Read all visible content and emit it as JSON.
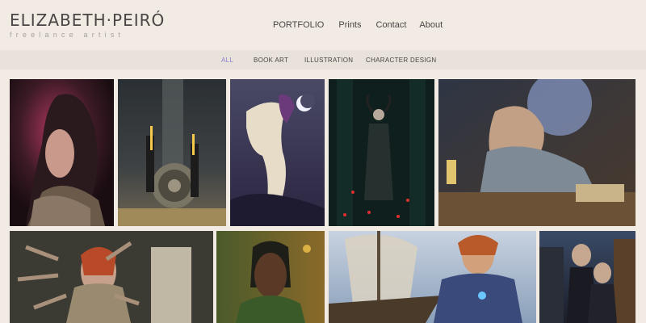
{
  "site": {
    "name": "ELIZABETH·PEIRÓ",
    "tagline": "freelance artist"
  },
  "nav": {
    "items": [
      "PORTFOLIO",
      "Prints",
      "Contact",
      "About"
    ]
  },
  "filters": {
    "items": [
      "ALL",
      "BOOK ART",
      "ILLUSTRATION",
      "CHARACTER DESIGN"
    ],
    "active": "ALL",
    "active_color": "#8d7fd0"
  },
  "gallery": {
    "items": [
      {
        "subject": "hooded warrior portrait in pink light"
      },
      {
        "subject": "two figures with glowing swords beside an ornate round shield"
      },
      {
        "subject": "rider on a rearing white horse under a crescent moon"
      },
      {
        "subject": "horned woman in a dark hall with red lights"
      },
      {
        "subject": "bearded craftsman working at a cluttered workbench"
      },
      {
        "subject": "red-haired woman surrounded by reaching hands"
      },
      {
        "subject": "elf portrait in a green hood"
      },
      {
        "subject": "red-haired man on a sailing ship"
      },
      {
        "subject": "two young figures in a dark street"
      }
    ]
  },
  "colors": {
    "background": "#f1ebe3",
    "filter_bar": "#e8e2db",
    "text": "#4a4544",
    "tagline": "#a7a19b"
  }
}
